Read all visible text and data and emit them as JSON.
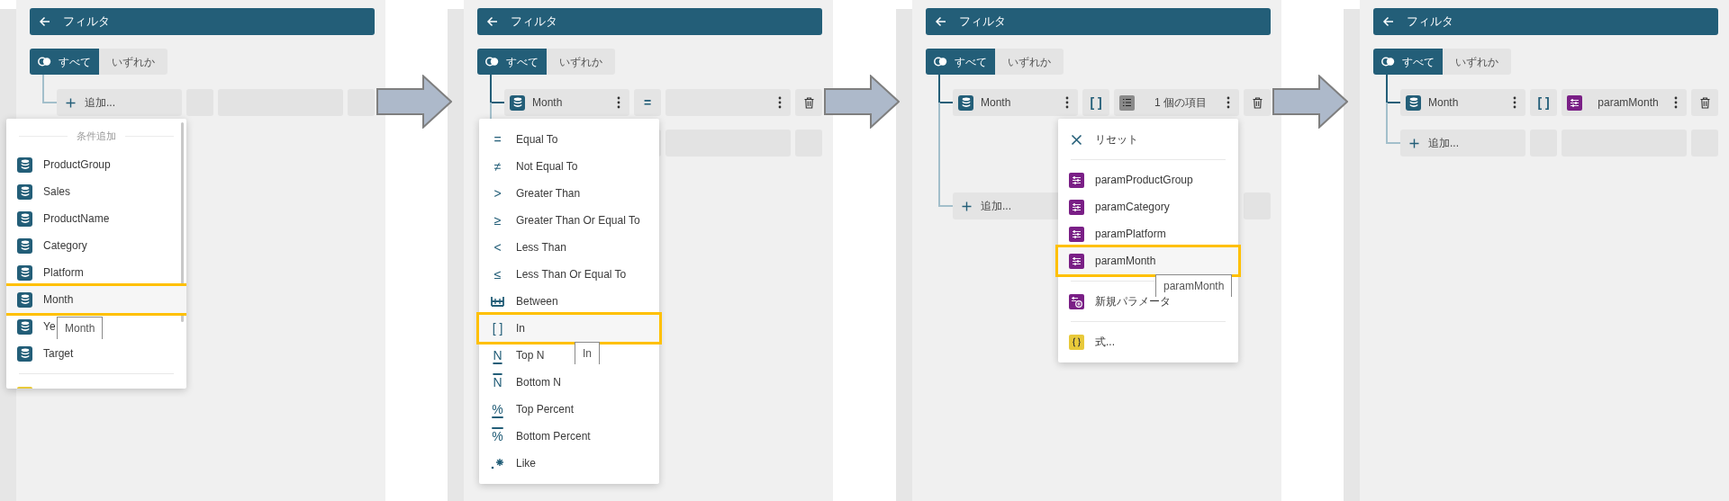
{
  "panels": [
    {
      "header": {
        "title": "フィルタ"
      },
      "mode_toggle": [
        {
          "label": "すべて",
          "selected": true
        },
        {
          "label": "いずれか",
          "selected": false
        }
      ],
      "add_button": "追加...",
      "add_menu": {
        "tooltip": "Month",
        "sections": [
          {
            "heading": "条件追加",
            "items": [
              {
                "kind": "field",
                "label": "ProductGroup",
                "selected": false
              },
              {
                "kind": "field",
                "label": "Sales",
                "selected": false
              },
              {
                "kind": "field",
                "label": "ProductName",
                "selected": false
              },
              {
                "kind": "field",
                "label": "Category",
                "selected": false
              },
              {
                "kind": "field",
                "label": "Platform",
                "selected": false
              },
              {
                "kind": "field",
                "label": "Month",
                "selected": true
              },
              {
                "kind": "field",
                "label": "Ye",
                "selected": false
              },
              {
                "kind": "field",
                "label": "Target",
                "selected": false
              }
            ]
          },
          {
            "items": [
              {
                "kind": "expression",
                "selected": false
              }
            ]
          }
        ]
      }
    },
    {
      "header": {
        "title": "フィルタ"
      },
      "mode_toggle": [
        {
          "label": "すべて",
          "selected": true
        },
        {
          "label": "いずれか",
          "selected": false
        }
      ],
      "conditions": [
        {
          "field": "Month",
          "operator": "=",
          "operator_menu": {
            "tooltip": "In",
            "sections": [
              {
                "items": [
                  {
                    "kind": "symbol",
                    "symbol": "=",
                    "label": "Equal To",
                    "selected": false
                  },
                  {
                    "kind": "symbol",
                    "symbol": "≠",
                    "label": "Not Equal To",
                    "selected": false
                  },
                  {
                    "kind": "symbol",
                    "symbol": ">",
                    "label": "Greater Than",
                    "selected": false
                  },
                  {
                    "kind": "symbol",
                    "symbol": "≥",
                    "label": "Greater Than Or Equal To",
                    "selected": false
                  },
                  {
                    "kind": "symbol",
                    "symbol": "<",
                    "label": "Less Than",
                    "selected": false
                  },
                  {
                    "kind": "symbol",
                    "symbol": "≤",
                    "label": "Less Than Or Equal To",
                    "selected": false
                  },
                  {
                    "kind": "between",
                    "label": "Between",
                    "selected": false
                  },
                  {
                    "kind": "symbol",
                    "symbol": "[ ]",
                    "label": "In",
                    "selected": true
                  },
                  {
                    "kind": "underlined",
                    "symbol": "N",
                    "label": "Top N",
                    "selected": false
                  },
                  {
                    "kind": "overlined",
                    "symbol": "N",
                    "label": "Bottom N",
                    "selected": false
                  },
                  {
                    "kind": "underlined",
                    "symbol": "%",
                    "label": "Top Percent",
                    "selected": false
                  },
                  {
                    "kind": "overlined",
                    "symbol": "%",
                    "label": "Bottom Percent",
                    "selected": false
                  },
                  {
                    "kind": "like",
                    "label": "Like",
                    "selected": false
                  }
                ]
              }
            ]
          }
        }
      ]
    },
    {
      "header": {
        "title": "フィルタ"
      },
      "mode_toggle": [
        {
          "label": "すべて",
          "selected": true
        },
        {
          "label": "いずれか",
          "selected": false
        }
      ],
      "conditions": [
        {
          "field": "Month",
          "operator": "[ ]",
          "value": {
            "kind": "list",
            "text": "1 個の項目"
          },
          "value_menu": {
            "tooltip": "paramMonth",
            "sections": [
              {
                "items": [
                  {
                    "kind": "reset",
                    "label": "リセット",
                    "selected": false
                  }
                ]
              },
              {
                "items": [
                  {
                    "kind": "parameter",
                    "label": "paramProductGroup",
                    "selected": false
                  },
                  {
                    "kind": "parameter",
                    "label": "paramCategory",
                    "selected": false
                  },
                  {
                    "kind": "parameter",
                    "label": "paramPlatform",
                    "selected": false
                  },
                  {
                    "kind": "parameter",
                    "label": "paramMonth",
                    "selected": true
                  }
                ]
              },
              {
                "items": [
                  {
                    "kind": "new_parameter",
                    "label": "新規パラメータ",
                    "selected": false
                  }
                ]
              },
              {
                "items": [
                  {
                    "kind": "expression",
                    "label": "式...",
                    "selected": false
                  }
                ]
              }
            ]
          }
        }
      ],
      "add_button": "追加..."
    },
    {
      "header": {
        "title": "フィルタ"
      },
      "mode_toggle": [
        {
          "label": "すべて",
          "selected": true
        },
        {
          "label": "いずれか",
          "selected": false
        }
      ],
      "conditions": [
        {
          "field": "Month",
          "operator": "[ ]",
          "value": {
            "kind": "parameter",
            "text": "paramMonth"
          }
        }
      ],
      "add_button": "追加..."
    }
  ]
}
